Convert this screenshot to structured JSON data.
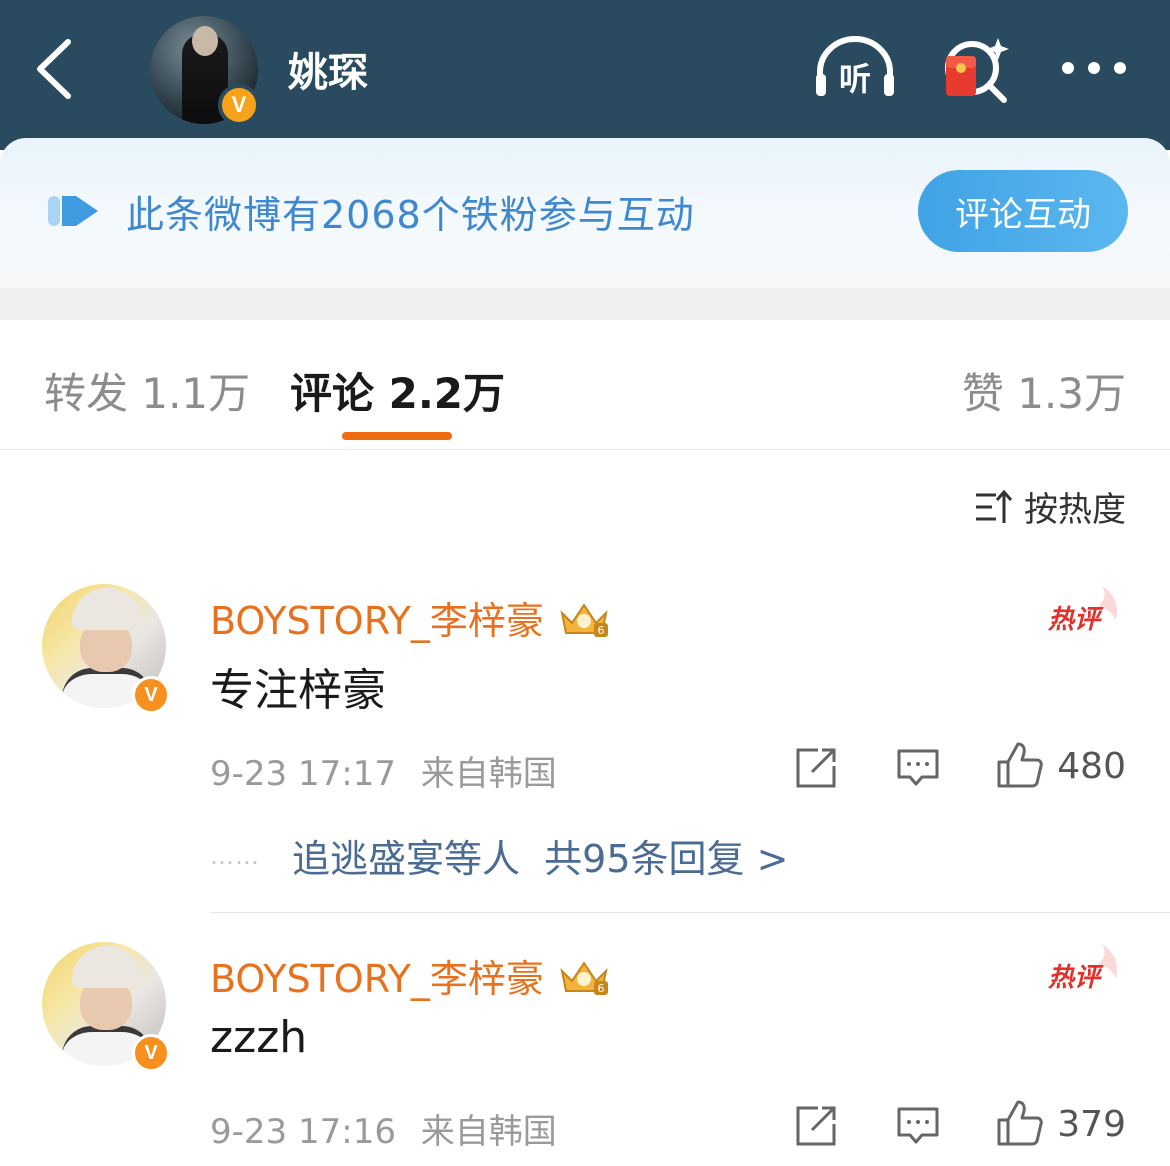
{
  "header": {
    "username": "姚琛",
    "verified_badge": "V",
    "back_icon": "chevron-left-icon",
    "listen_icon": "headphones-icon",
    "listen_label": "听",
    "redpack_icon": "red-packet-search-icon",
    "more_icon": "ellipsis-icon"
  },
  "fan_banner": {
    "text": "此条微博有2068个铁粉参与互动",
    "button_label": "评论互动",
    "icon": "play-arrow-icon"
  },
  "tabs": [
    {
      "label": "转发 1.1万",
      "active": false
    },
    {
      "label": "评论 2.2万",
      "active": true
    },
    {
      "label": "赞 1.3万",
      "active": false
    }
  ],
  "sort": {
    "label": "按热度",
    "icon": "sort-icon"
  },
  "comments": [
    {
      "name": "BOYSTORY_李梓豪",
      "badge": "V",
      "crown_level": "6",
      "hot_label": "热评",
      "text": "专注梓豪",
      "time": "9-23 17:17",
      "location": "来自韩国",
      "likes": "480",
      "replies_dots": "……",
      "replies_text": "追逃盛宴等人  共95条回复 >"
    },
    {
      "name": "BOYSTORY_李梓豪",
      "badge": "V",
      "crown_level": "6",
      "hot_label": "热评",
      "text": "zzzh",
      "time": "9-23 17:16",
      "location": "来自韩国",
      "likes": "379"
    }
  ],
  "colors": {
    "header_bg": "#294a5f",
    "accent_orange": "#f06a0f",
    "name_orange": "#e8711d",
    "banner_blue": "#3f88cf",
    "reply_link": "#4a6b93"
  }
}
